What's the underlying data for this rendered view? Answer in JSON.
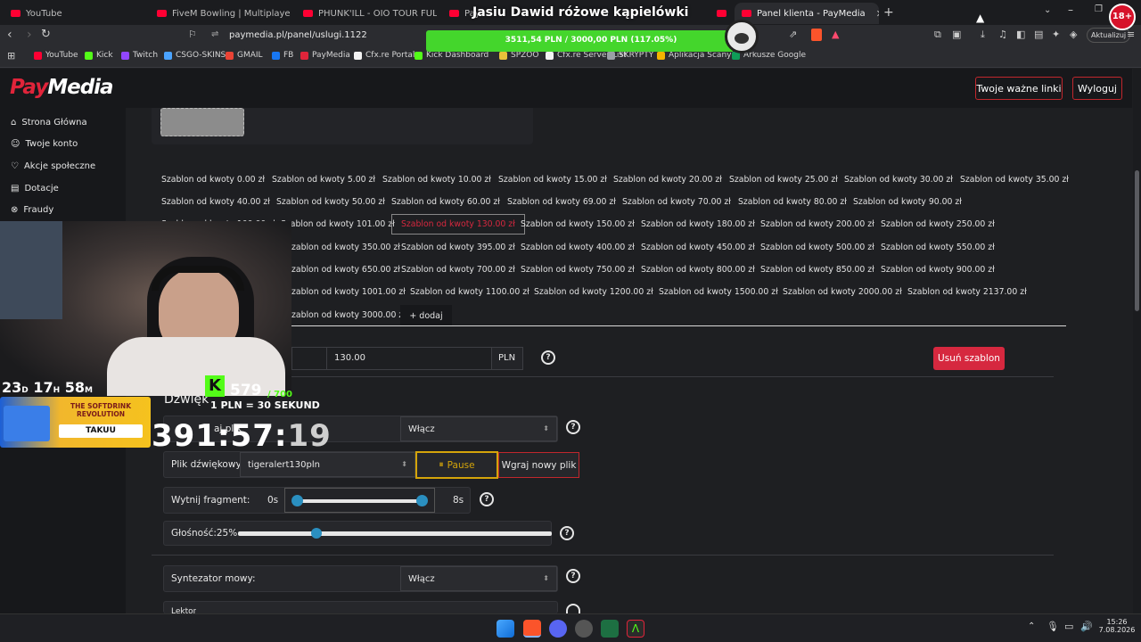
{
  "browser": {
    "tabs": [
      {
        "label": "YouTube"
      },
      {
        "label": "FiveM Bowling | Multiplayer, Synced"
      },
      {
        "label": "PHUNK'ILL - OIO TOUR FULL DJ SET"
      },
      {
        "label": "Pay"
      },
      {
        "label": "Panel klienta - PayMedia"
      }
    ],
    "url": "paymedia.pl/panel/uslugi.1122",
    "update_label": "Aktualizuj",
    "bookmarks": [
      {
        "label": "YouTube",
        "color": "#ff0033"
      },
      {
        "label": "Kick",
        "color": "#53fc18"
      },
      {
        "label": "Twitch",
        "color": "#9146ff"
      },
      {
        "label": "CSGO-SKINS",
        "color": "#4aa3ff"
      },
      {
        "label": "GMAIL",
        "color": "#ea4335"
      },
      {
        "label": "FB",
        "color": "#1877f2"
      },
      {
        "label": "PayMedia",
        "color": "#e0243a"
      },
      {
        "label": "Cfx.re Portal",
        "color": "#f3f3f3"
      },
      {
        "label": "Kick Dashboard",
        "color": "#53fc18"
      },
      {
        "label": "SPZOO",
        "color": "#e8c13a"
      },
      {
        "label": "Cfx.re Server List",
        "color": "#f3f3f3"
      },
      {
        "label": "SKRYPTY",
        "color": "#9aa0a6"
      },
      {
        "label": "Aplikacja Scanye",
        "color": "#f4b400"
      },
      {
        "label": "Arkusze Google",
        "color": "#0f9d58"
      }
    ]
  },
  "goal": {
    "title": "Jasiu Dawid różowe kąpielówki",
    "progress_text": "3511,54 PLN / 3000,00 PLN (117.05%)",
    "progress": 1.1705
  },
  "header": {
    "logo_pay": "Pay",
    "logo_media": "Media",
    "links_button": "Twoje ważne linki",
    "logout_button": "Wyloguj"
  },
  "sidebar": {
    "items": [
      {
        "label": "Strona Główna",
        "icon": "home-icon"
      },
      {
        "label": "Twoje konto",
        "icon": "user-icon"
      },
      {
        "label": "Akcje społeczne",
        "icon": "heart-icon"
      },
      {
        "label": "Dotacje",
        "icon": "document-icon"
      },
      {
        "label": "Fraudy",
        "icon": "cancel-icon"
      }
    ]
  },
  "templates": {
    "rows": [
      [
        "Szablon od kwoty 0.00 zł",
        "Szablon od kwoty 5.00 zł",
        "Szablon od kwoty 10.00 zł",
        "Szablon od kwoty 15.00 zł",
        "Szablon od kwoty 20.00 zł",
        "Szablon od kwoty 25.00 zł",
        "Szablon od kwoty 30.00 zł",
        "Szablon od kwoty 35.00 zł"
      ],
      [
        "Szablon od kwoty 40.00 zł",
        "Szablon od kwoty 50.00 zł",
        "Szablon od kwoty 60.00 zł",
        "Szablon od kwoty 69.00 zł",
        "Szablon od kwoty 70.00 zł",
        "Szablon od kwoty 80.00 zł",
        "Szablon od kwoty 90.00 zł"
      ],
      [
        "Szablon od kwoty 100.00 zł",
        "Szablon od kwoty 101.00 zł",
        "Szablon od kwoty 130.00 zł",
        "Szablon od kwoty 150.00 zł",
        "Szablon od kwoty 180.00 zł",
        "Szablon od kwoty 200.00 zł",
        "Szablon od kwoty 250.00 zł"
      ],
      [
        "zablon od kwoty 350.00 zł",
        "Szablon od kwoty 395.00 zł",
        "Szablon od kwoty 400.00 zł",
        "Szablon od kwoty 450.00 zł",
        "Szablon od kwoty 500.00 zł",
        "Szablon od kwoty 550.00 zł"
      ],
      [
        "zablon od kwoty 650.00 zł",
        "Szablon od kwoty 700.00 zł",
        "Szablon od kwoty 750.00 zł",
        "Szablon od kwoty 800.00 zł",
        "Szablon od kwoty 850.00 zł",
        "Szablon od kwoty 900.00 zł"
      ],
      [
        "zablon od kwoty 1001.00 zł",
        "Szablon od kwoty 1100.00 zł",
        "Szablon od kwoty 1200.00 zł",
        "Szablon od kwoty 1500.00 zł",
        "Szablon od kwoty 2000.00 zł",
        "Szablon od kwoty 2137.00 zł"
      ],
      [
        "zablon od kwoty 3000.00 zł"
      ]
    ],
    "add_label": "+ dodaj"
  },
  "amount": {
    "value": "130.00",
    "currency": "PLN",
    "delete_button": "Usuń szablon"
  },
  "sound": {
    "section_title": "Dźwięk",
    "play_label": "aj plik",
    "play_value": "Włącz",
    "file_label": "Plik dźwiękowy:",
    "file_value": "tigeralert130pln",
    "pause_button": "Pause",
    "upload_button": "Wgraj nowy plik",
    "cut_label": "Wytnij fragment:",
    "cut_start": "0s",
    "cut_end": "8s",
    "volume_label": "Głośność:25%",
    "volume": 0.25
  },
  "tts": {
    "label": "Syntezator mowy:",
    "value": "Włącz",
    "next_label": "Lektor"
  },
  "overlay": {
    "timer_days": "23",
    "timer_d": "D",
    "timer_hours": "17",
    "timer_h": "H",
    "timer_min": "58",
    "timer_m": "M",
    "followers": "579",
    "followers_goal": "/ 700",
    "rate": "1 PLN = 30 SEKUND",
    "countdown_main": "391:57:",
    "countdown_sec": "19",
    "ad_line1": "THE SOFTDRINK",
    "ad_line2": "REVOLUTION",
    "ad_code": "TAKUU",
    "age_badge": "18+"
  },
  "taskbar": {
    "time": "15:26",
    "date": "7.08.2026"
  }
}
